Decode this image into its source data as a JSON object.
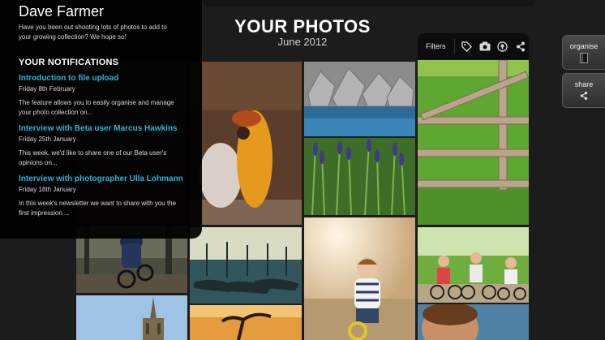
{
  "header": {
    "title": "YOUR PHOTOS",
    "subtitle": "June 2012"
  },
  "panel": {
    "user_name": "Dave Farmer",
    "intro": "Have you been out shooting lots of photos to add to your growing collection? We hope so!",
    "heading": "YOUR NOTIFICATIONS",
    "notifications": [
      {
        "title": "Introduction to file upload",
        "date": "Friday 8th February",
        "text": "The feature allows you to easily organise and manage your photo collection on..."
      },
      {
        "title": "Interview with Beta user Marcus Hawkins",
        "date": "Friday 25th January",
        "text": "This week, we'd like to share one of our Beta user's opinions on..."
      },
      {
        "title": "Interview with photographer Ulla Lohmann",
        "date": "Friday 18th January",
        "text": "In this week's newsletter we want to share with you the first impression ..."
      }
    ]
  },
  "filters": {
    "label": "Filters",
    "icons": [
      "tag-icon",
      "camera-icon",
      "location-icon",
      "share-icon"
    ]
  },
  "actions": {
    "organise_label": "organise",
    "share_label": "share"
  },
  "colors": {
    "background": "#1c1c1c",
    "panel": "#000000",
    "link": "#27b5dc"
  }
}
